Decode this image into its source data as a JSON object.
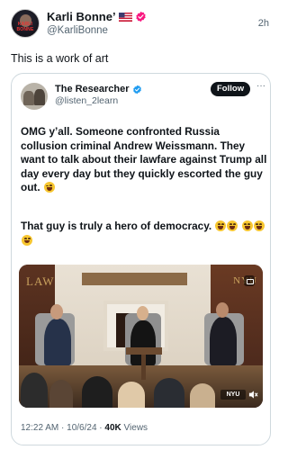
{
  "post": {
    "author_name": "Karli Bonne’",
    "author_handle": "@KarliBonne",
    "time": "2h",
    "text": "This is a work of art",
    "avatar_text": "KARLI BONNE"
  },
  "quoted": {
    "author_name": "The Researcher",
    "author_handle": "@listen_2learn",
    "follow_label": "Follow",
    "more_label": "···",
    "text_main": "OMG y’all. Someone confronted Russia collusion criminal Andrew Weissmann. They want to talk about their lawfare against Trump all day every day but they quickly escorted the guy out.",
    "text_second": "That guy is truly a hero of democracy.",
    "media": {
      "left_sign": "LAW",
      "right_sign": "NYU",
      "badge": "NYU"
    },
    "timestamp": "12:22 AM · 10/6/24 ·",
    "views": "40K",
    "views_label": "Views"
  },
  "colors": {
    "verified": "#f91880",
    "quoted_verified": "#1d9bf0",
    "text": "#0f1419",
    "muted": "#536471",
    "border": "#cfd9de"
  },
  "icons": [
    "us-flag-icon",
    "verified-badge-icon",
    "laughing-emoji-icon",
    "wink-emoji-icon",
    "media-expand-icon",
    "volume-icon"
  ]
}
